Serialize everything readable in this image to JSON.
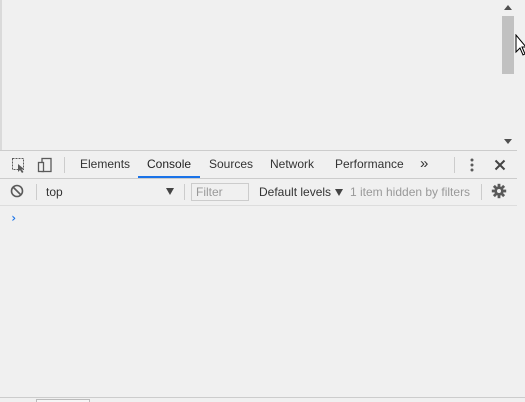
{
  "devtools": {
    "tabs": [
      {
        "label": "Elements"
      },
      {
        "label": "Console"
      },
      {
        "label": "Sources"
      },
      {
        "label": "Network"
      },
      {
        "label": "Performance"
      }
    ],
    "more_tabs_glyph": "»",
    "active_tab": "Console"
  },
  "console": {
    "context": "top",
    "filter_placeholder": "Filter",
    "levels_label": "Default levels",
    "hidden_message": "1 item hidden by filters",
    "prompt_glyph": "›"
  },
  "icons": {
    "inspect": "inspect-element-icon",
    "device": "device-toolbar-icon",
    "more_tabs": "chevron-double-right-icon",
    "menu": "kebab-menu-icon",
    "close": "close-icon",
    "clear": "clear-console-icon",
    "settings": "gear-icon"
  },
  "colors": {
    "accent": "#1a73e8",
    "background": "#f0f0f0"
  }
}
